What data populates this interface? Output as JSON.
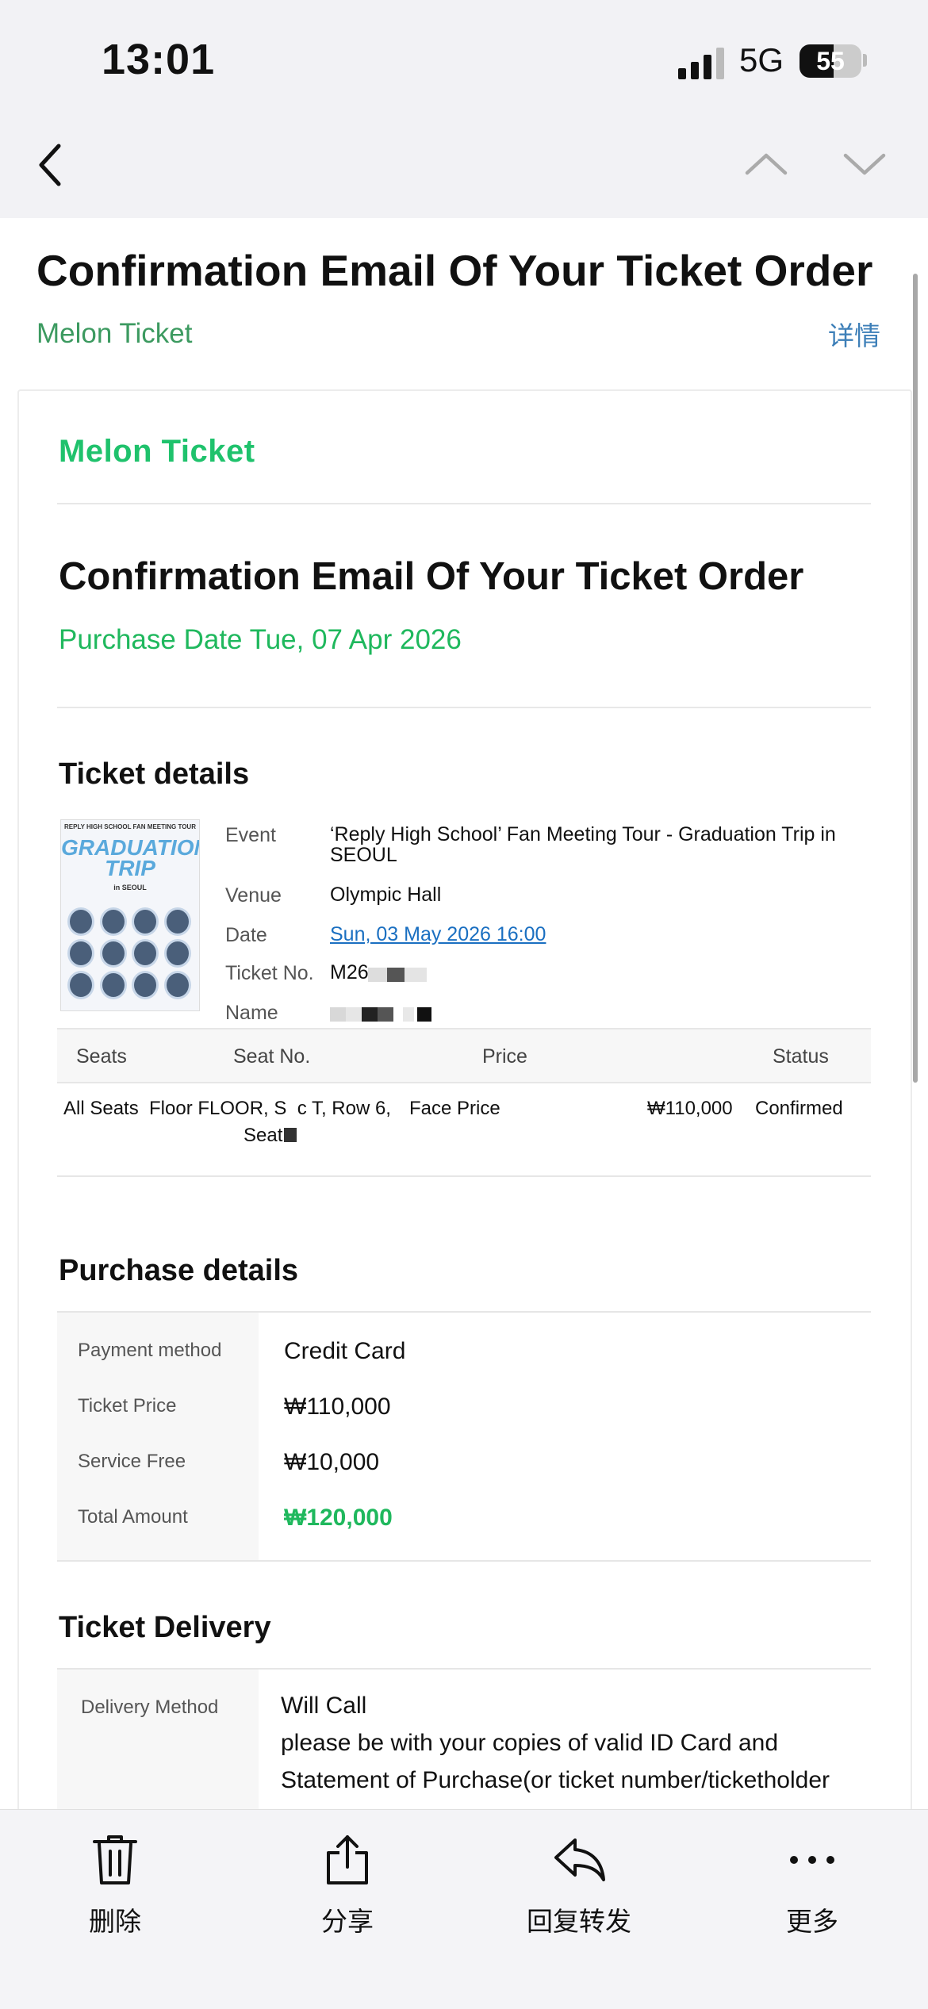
{
  "status_bar": {
    "time": "13:01",
    "network": "5G",
    "battery": "55",
    "battery_level": 0.55
  },
  "nav": {
    "back_icon": "chevron-left-icon",
    "prev_icon": "chevron-up-icon",
    "next_icon": "chevron-down-icon"
  },
  "message": {
    "title": "Confirmation Email Of Your Ticket Order",
    "sender": "Melon Ticket",
    "detail_link": "详情"
  },
  "email": {
    "logo": "Melon Ticket",
    "title": "Confirmation Email Of Your Ticket Order",
    "purchase_date": "Purchase Date Tue, 07 Apr 2026",
    "ticket_details": {
      "heading": "Ticket details",
      "poster": {
        "top": "REPLY HIGH SCHOOL FAN MEETING TOUR",
        "main": "GRADUATION TRIP",
        "sub": "in SEOUL"
      },
      "labels": {
        "event": "Event",
        "venue": "Venue",
        "date": "Date",
        "ticket_no": "Ticket No.",
        "name": "Name"
      },
      "event": "‘Reply High School’ Fan Meeting Tour - Graduation Trip in SEOUL",
      "venue": "Olympic Hall",
      "date": "Sun, 03 May 2026 16:00",
      "ticket_no": "M26"
    },
    "seats_table": {
      "headers": {
        "seats": "Seats",
        "seat_no": "Seat No.",
        "price": "Price",
        "status": "Status"
      },
      "row": {
        "seats": "All Seats",
        "seat_no_line1": "Floor FLOOR, S  c T, Row 6,",
        "seat_no_line2": "Seat",
        "price_type": "Face Price",
        "amount": "₩110,000",
        "status": "Confirmed"
      }
    },
    "purchase_details": {
      "heading": "Purchase details",
      "rows": [
        {
          "label": "Payment method",
          "value": "Credit Card"
        },
        {
          "label": "Ticket Price",
          "value": "₩110,000"
        },
        {
          "label": "Service Free",
          "value": "₩10,000"
        },
        {
          "label": "Total Amount",
          "value": "₩120,000"
        }
      ]
    },
    "delivery": {
      "heading": "Ticket Delivery",
      "label": "Delivery Method",
      "method": "Will Call",
      "note_line1": "please be with your copies of valid ID Card and",
      "note_line2": "Statement of Purchase(or ticket number/ticketholder"
    }
  },
  "toolbar": {
    "delete": "删除",
    "share": "分享",
    "reply": "回复转发",
    "more": "更多"
  },
  "colors": {
    "brand_green": "#1fc26c",
    "sender_green": "#3c9a60",
    "link_blue": "#1a6fc1"
  }
}
